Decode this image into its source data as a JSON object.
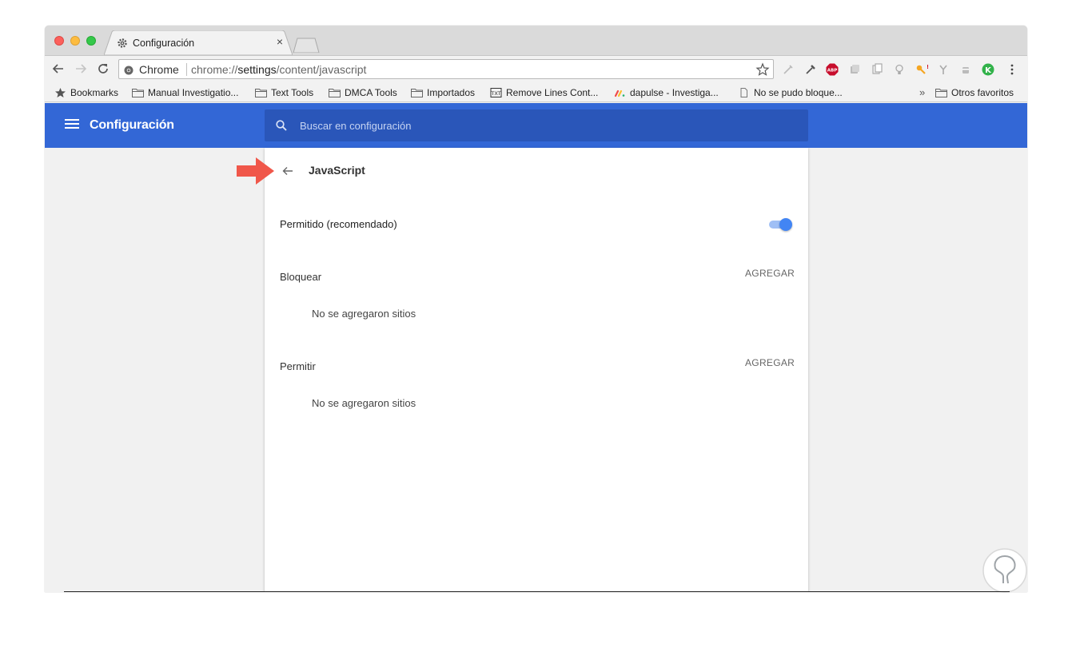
{
  "tab": {
    "title": "Configuración",
    "close_glyph": "×"
  },
  "toolbar": {
    "omnibox_chip": "Chrome",
    "url_scheme": "chrome://",
    "url_host": "settings",
    "url_path": "/content/javascript"
  },
  "bookmarks": {
    "items": [
      {
        "label": "Bookmarks",
        "icon": "star-icon"
      },
      {
        "label": "Manual Investigatio...",
        "icon": "folder-icon"
      },
      {
        "label": "Text Tools",
        "icon": "folder-icon"
      },
      {
        "label": "DMCA Tools",
        "icon": "folder-icon"
      },
      {
        "label": "Importados",
        "icon": "folder-icon"
      },
      {
        "label": "Remove Lines Cont...",
        "icon": "txt-icon"
      },
      {
        "label": "dapulse - Investiga...",
        "icon": "dapulse-icon"
      },
      {
        "label": "No se pudo bloque...",
        "icon": "page-icon"
      }
    ],
    "overflow": "»",
    "other": "Otros favoritos"
  },
  "header": {
    "title": "Configuración",
    "search_placeholder": "Buscar en configuración"
  },
  "page": {
    "title": "JavaScript",
    "allowed_label": "Permitido (recomendado)",
    "allowed_enabled": true,
    "block_label": "Bloquear",
    "block_add": "AGREGAR",
    "block_empty": "No se agregaron sitios",
    "allow_label": "Permitir",
    "allow_add": "AGREGAR",
    "allow_empty": "No se agregaron sitios"
  },
  "colors": {
    "header_blue": "#3367d6",
    "search_blue": "#2a56b9",
    "toggle_blue": "#4285f4",
    "annotation_red": "#f0574a"
  }
}
